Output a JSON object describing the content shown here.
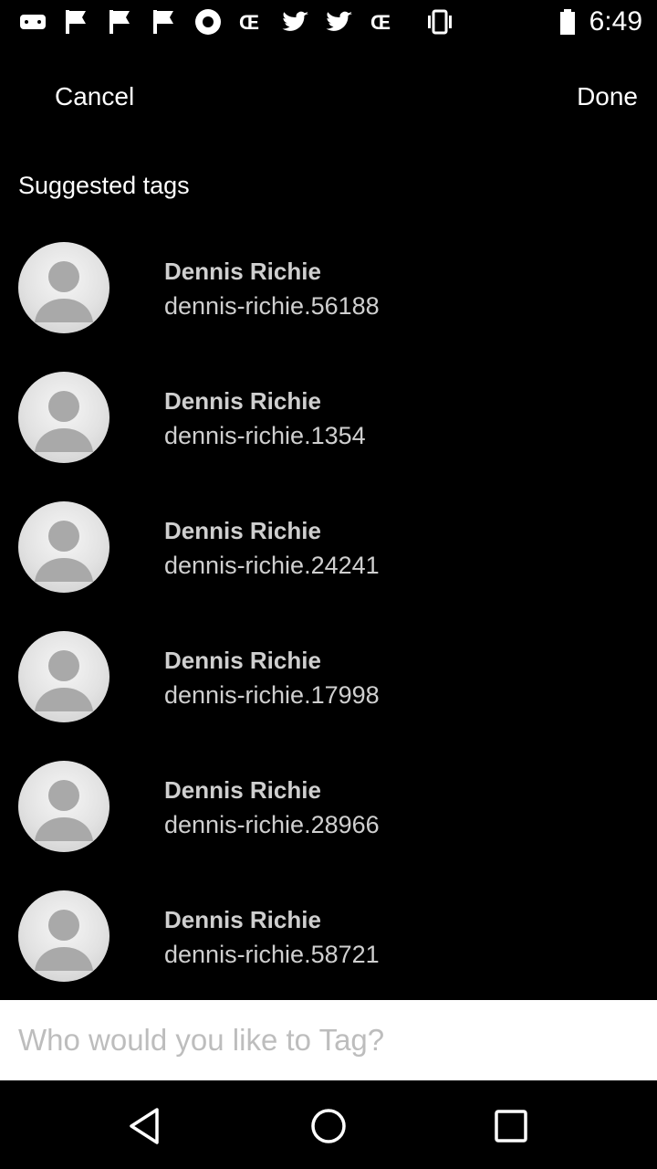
{
  "status_bar": {
    "time": "6:49",
    "icons": [
      "gamepad-icon",
      "flag-icon",
      "flag-icon",
      "record-icon",
      "pinterest-icon",
      "twitter-icon",
      "twitter-icon",
      "pinterest-icon",
      "vibrate-icon",
      "battery-icon"
    ]
  },
  "header": {
    "cancel_label": "Cancel",
    "done_label": "Done"
  },
  "section_title": "Suggested tags",
  "suggestions": [
    {
      "name": "Dennis Richie",
      "handle": "dennis-richie.56188"
    },
    {
      "name": "Dennis Richie",
      "handle": "dennis-richie.1354"
    },
    {
      "name": "Dennis Richie",
      "handle": "dennis-richie.24241"
    },
    {
      "name": "Dennis Richie",
      "handle": "dennis-richie.17998"
    },
    {
      "name": "Dennis Richie",
      "handle": "dennis-richie.28966"
    },
    {
      "name": "Dennis Richie",
      "handle": "dennis-richie.58721"
    }
  ],
  "tag_input": {
    "placeholder": "Who would you like to Tag?",
    "value": ""
  },
  "nav": {
    "back": "back-icon",
    "home": "home-icon",
    "recents": "recents-icon"
  }
}
